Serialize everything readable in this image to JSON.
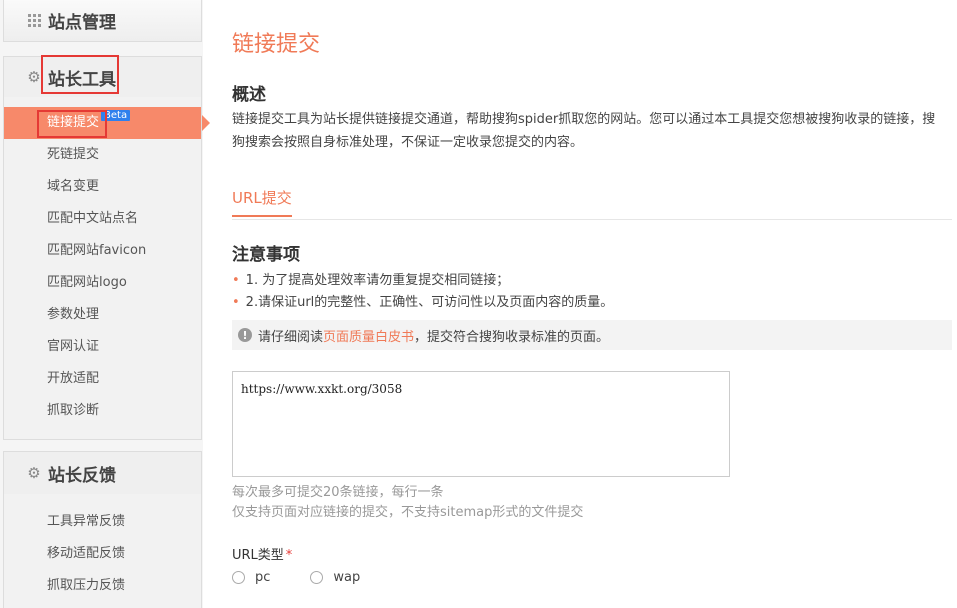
{
  "sidebar": {
    "site_management": {
      "title": "站点管理",
      "icon": "grid-icon"
    },
    "webmaster_tools": {
      "title": "站长工具",
      "icon": "gear-icon",
      "items": [
        {
          "label": "链接提交",
          "badge": "Beta",
          "active": true
        },
        {
          "label": "死链提交"
        },
        {
          "label": "域名变更"
        },
        {
          "label": "匹配中文站点名"
        },
        {
          "label": "匹配网站favicon"
        },
        {
          "label": "匹配网站logo"
        },
        {
          "label": "参数处理"
        },
        {
          "label": "官网认证"
        },
        {
          "label": "开放适配"
        },
        {
          "label": "抓取诊断"
        }
      ]
    },
    "webmaster_feedback": {
      "title": "站长反馈",
      "icon": "gear-icon",
      "items": [
        {
          "label": "工具异常反馈"
        },
        {
          "label": "移动适配反馈"
        },
        {
          "label": "抓取压力反馈"
        }
      ]
    }
  },
  "main": {
    "page_title": "链接提交",
    "overview_title": "概述",
    "overview_text": "链接提交工具为站长提供链接提交通道，帮助搜狗spider抓取您的网站。您可以通过本工具提交您想被搜狗收录的链接，搜狗搜索会按照自身标准处理，不保证一定收录您提交的内容。",
    "tab_label": "URL提交",
    "notes_title": "注意事项",
    "notes": [
      "1. 为了提高处理效率请勿重复提交相同链接；",
      "2.请保证url的完整性、正确性、可访问性以及页面内容的质量。"
    ],
    "tip": {
      "prefix": "请仔细阅读",
      "link": "页面质量白皮书",
      "suffix": "，提交符合搜狗收录标准的页面。"
    },
    "url_input_value": "https://www.xxkt.org/3058",
    "hint_line1": "每次最多可提交20条链接，每行一条",
    "hint_line2": "仅支持页面对应链接的提交，不支持sitemap形式的文件提交",
    "url_type_label": "URL类型",
    "required_mark": "*",
    "url_type_options": [
      "pc",
      "wap"
    ]
  },
  "colors": {
    "accent": "#f07a57",
    "active_bg": "#f7896a",
    "highlight_box": "#e53935",
    "beta_badge": "#2f80ed"
  }
}
